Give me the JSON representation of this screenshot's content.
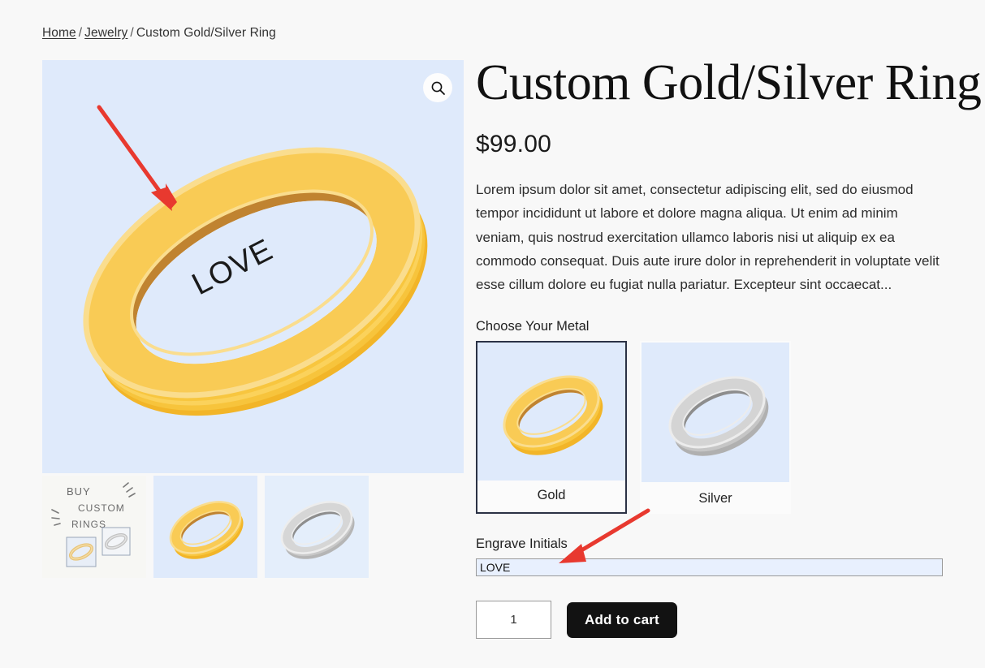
{
  "breadcrumb": {
    "home": "Home",
    "category": "Jewelry",
    "separator": "/",
    "current": "Custom Gold/Silver Ring"
  },
  "gallery": {
    "zoom_icon": "search-icon",
    "main_image_alt": "Gold ring with LOVE engraving",
    "engraving_on_ring": "LOVE",
    "background_color": "#dfeafb",
    "thumbnails": [
      {
        "label": "BUY CUSTOM RINGS promo",
        "promo_line1": "BUY",
        "promo_line2": "CUSTOM",
        "promo_line3": "RINGS"
      },
      {
        "label": "Gold ring"
      },
      {
        "label": "Silver ring"
      }
    ]
  },
  "product": {
    "title": "Custom Gold/Silver Ring",
    "price": "$99.00",
    "description": "Lorem ipsum dolor sit amet, consectetur adipiscing elit, sed do eiusmod tempor incididunt ut labore et dolore magna aliqua. Ut enim ad minim veniam, quis nostrud exercitation ullamco laboris nisi ut aliquip ex ea commodo consequat. Duis aute irure dolor in reprehenderit in voluptate velit esse cillum dolore eu fugiat nulla pariatur. Excepteur sint occaecat..."
  },
  "options": {
    "metal_label": "Choose Your Metal",
    "metals": [
      {
        "name": "Gold",
        "selected": true
      },
      {
        "name": "Silver",
        "selected": false
      }
    ],
    "engrave_label": "Engrave Initials",
    "engrave_value": "LOVE",
    "engrave_placeholder": ""
  },
  "cart": {
    "quantity": "1",
    "add_to_cart_label": "Add to cart"
  },
  "colors": {
    "page_background": "#f8f8f8",
    "image_background": "#dfeafb",
    "selected_border": "#2b3245",
    "button_background": "#121212",
    "annotation_arrow": "#e8392f",
    "input_autofill": "#e8f0fe"
  },
  "annotations": [
    {
      "name": "arrow-to-engraving",
      "color": "#e8392f"
    },
    {
      "name": "arrow-to-engrave-input",
      "color": "#e8392f"
    }
  ]
}
